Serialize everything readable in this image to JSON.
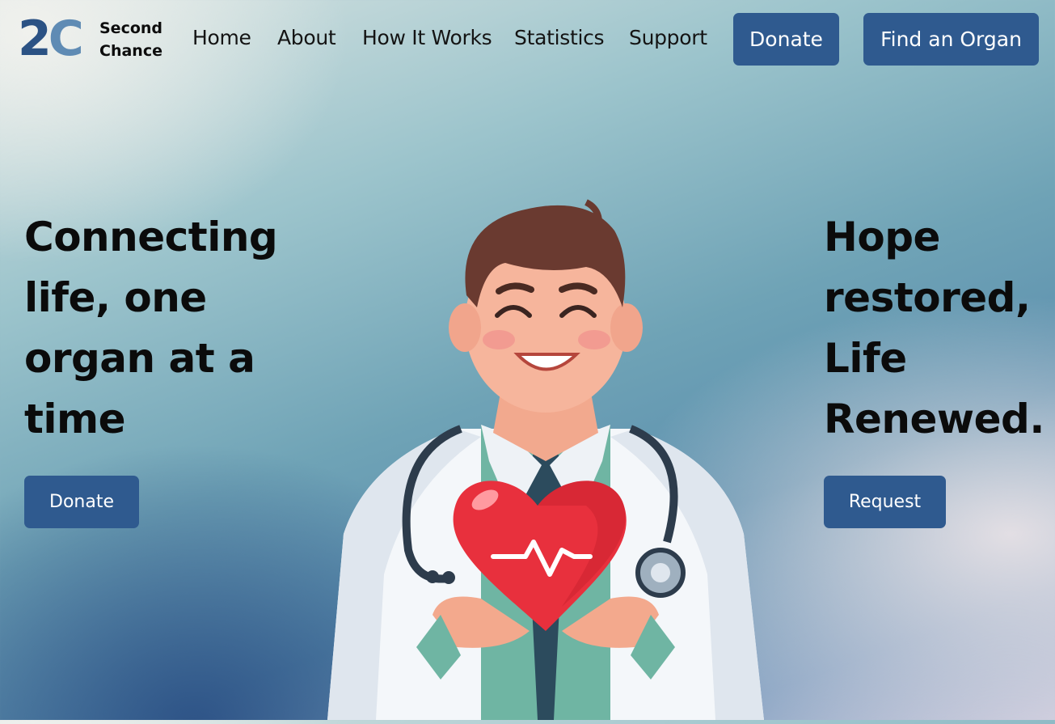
{
  "brand": {
    "mark_number": "2",
    "mark_letter": "C",
    "name_line1": "Second",
    "name_line2": "Chance"
  },
  "nav": {
    "links": [
      "Home",
      "About",
      "How It Works",
      "Statistics",
      "Support"
    ],
    "donate_label": "Donate",
    "find_label": "Find an Organ"
  },
  "hero": {
    "left_title_lines": [
      "Connecting",
      "life, one",
      "organ at a",
      "time"
    ],
    "left_button": "Donate",
    "right_title_lines": [
      "Hope",
      "restored,",
      "Life",
      "Renewed."
    ],
    "right_button": "Request"
  },
  "colors": {
    "primary_button": "#2f5a8f",
    "logo_dark": "#2b5284",
    "logo_light": "#5f8bb4",
    "heart": "#e8303d"
  },
  "illustration": {
    "icon": "doctor-holding-heart-illustration"
  }
}
